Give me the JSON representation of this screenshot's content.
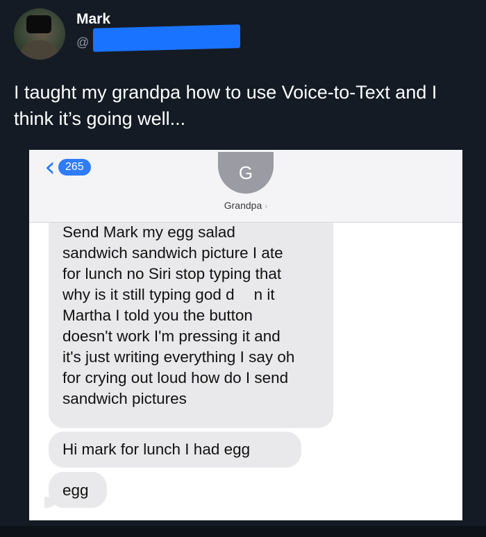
{
  "tweet": {
    "display_name": "Mark",
    "handle_prefix": "@",
    "text": "I taught my grandpa how to use Voice-to-Text and I think it’s going well..."
  },
  "screenshot": {
    "back_badge": "265",
    "back_icon": "chevron-left-icon",
    "contact_initial": "G",
    "contact_name": "Grandpa",
    "contact_chevron": "›",
    "accent_color": "#2f7cf6",
    "messages": [
      {
        "lines": [
          "Send Mark my egg salad",
          "sandwich sandwich picture I ate",
          "for lunch no Siri stop typing that",
          "why is it still typing god d",
          "n it",
          "Martha I told you the button",
          "doesn't work I'm pressing it and",
          "it's just writing everything I say oh",
          "for crying out loud how do I send",
          "sandwich pictures"
        ]
      },
      {
        "text": "Hi mark for lunch I had egg"
      },
      {
        "text": "egg"
      }
    ]
  }
}
